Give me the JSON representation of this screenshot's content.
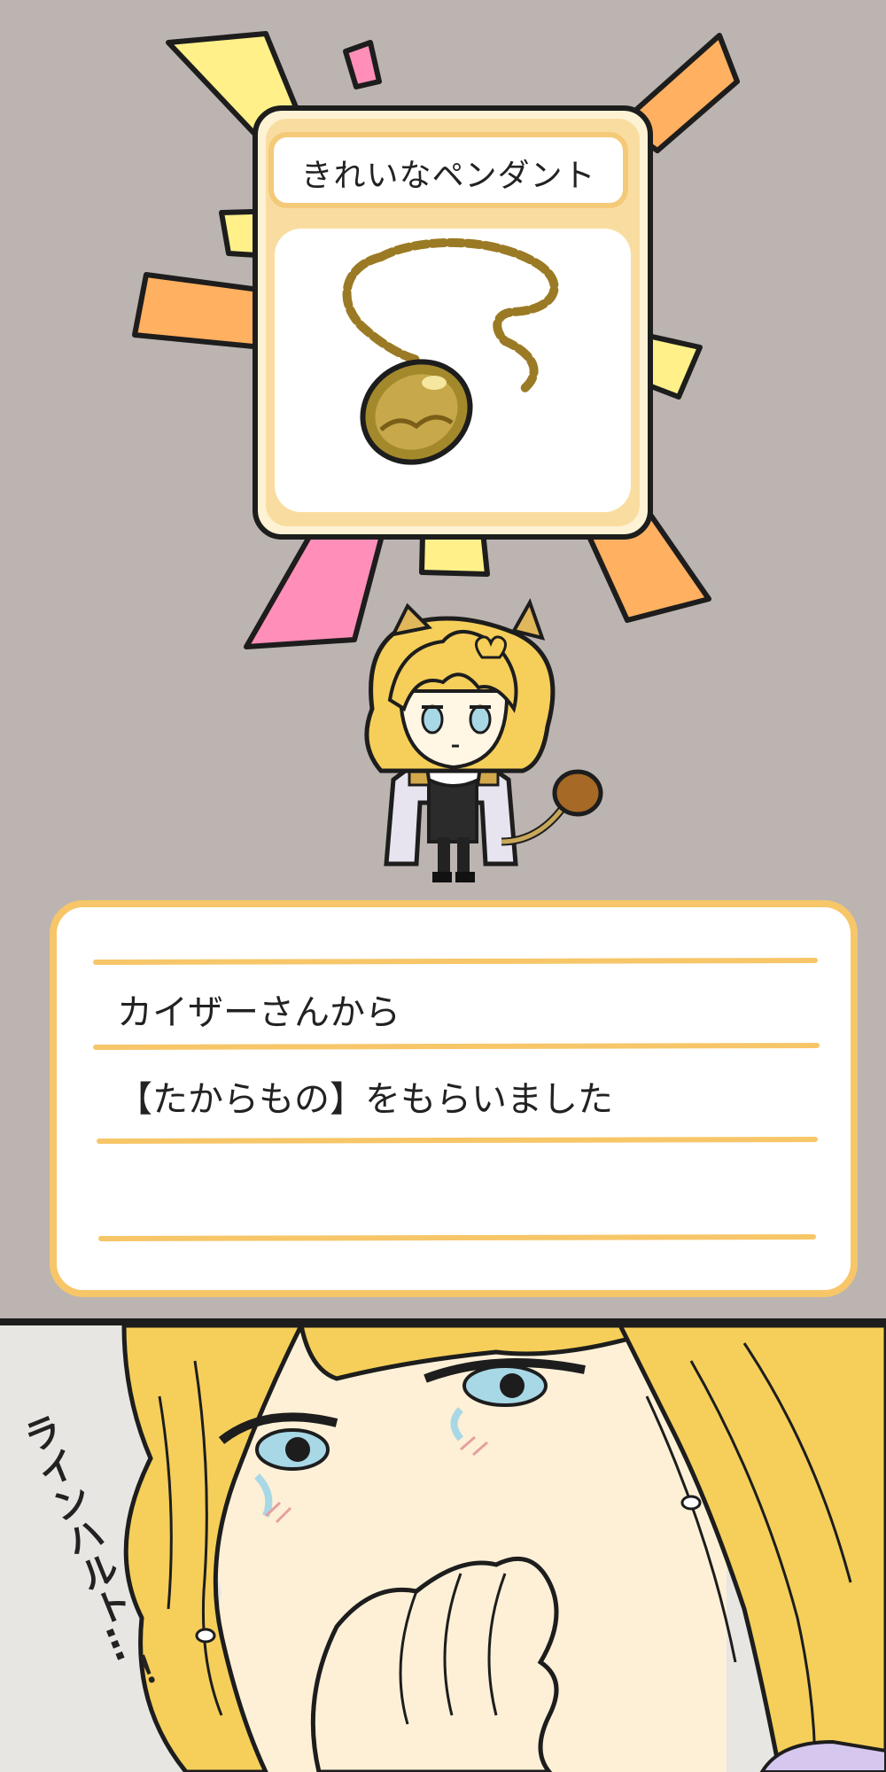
{
  "item_card": {
    "title": "きれいなペンダント",
    "item_name": "pendant-icon"
  },
  "dialog": {
    "line1": "カイザーさんから",
    "line2": "【たからもの】をもらいました",
    "line3": ""
  },
  "bottom_panel": {
    "exclamation": "ラインハルト…！"
  },
  "colors": {
    "background": "#bcb4b0",
    "card_border": "#f4c978",
    "card_fill": "#fdf2d4",
    "burst_yellow": "#fff08a",
    "burst_orange": "#ffb060",
    "burst_pink": "#ff8fb8",
    "hair": "#f5cf5a"
  }
}
